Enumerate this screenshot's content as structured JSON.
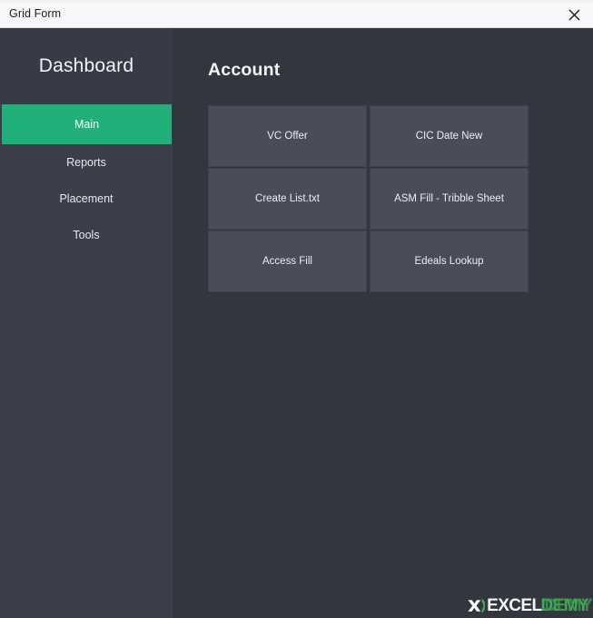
{
  "window": {
    "title": "Grid Form",
    "close_label": "Close",
    "close_icon": "close-icon"
  },
  "sidebar": {
    "brand": "Dashboard",
    "items": [
      {
        "label": "Main",
        "active": true
      },
      {
        "label": "Reports",
        "active": false
      },
      {
        "label": "Placement",
        "active": false
      },
      {
        "label": "Tools",
        "active": false
      }
    ],
    "accent_color": "#21b07a",
    "background_color": "#3b3f4a",
    "header_background_color": "#383b46"
  },
  "main": {
    "heading": "Account",
    "background_color": "#33363f",
    "tiles": [
      {
        "label": "VC Offer"
      },
      {
        "label": "CIC Date New"
      },
      {
        "label": "Create List.txt"
      },
      {
        "label": "ASM Fill - Tribble Sheet"
      },
      {
        "label": "Access Fill"
      },
      {
        "label": "Edeals Lookup"
      }
    ],
    "tile_background_color": "#494d59"
  },
  "watermark": {
    "part_one": "EXCEL",
    "part_two": "DEMY",
    "part_two_ghost": "DEMY",
    "mark_icon": "excel-x-icon",
    "green_color": "#3faa55"
  }
}
